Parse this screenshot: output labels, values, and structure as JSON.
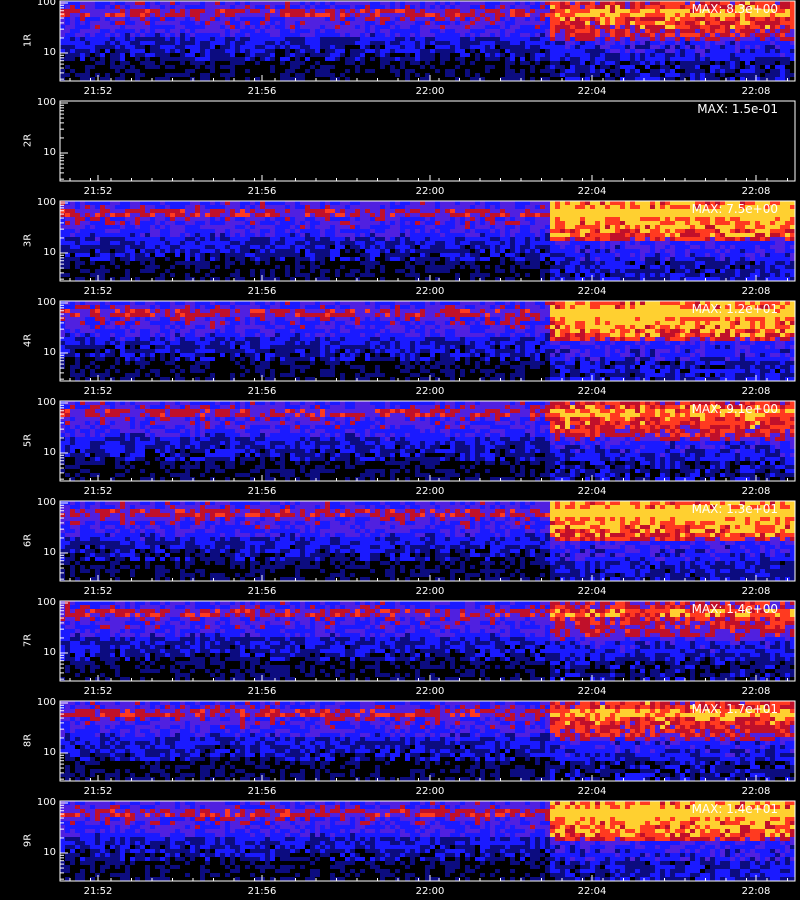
{
  "chart_data": [
    {
      "type": "heatmap",
      "ylabel": "1R",
      "max_label": "MAX: 8.3e+00",
      "y_ticks": [
        "100",
        "10"
      ],
      "yscale": "log",
      "x_ticks": [
        "21:52",
        "21:56",
        "22:00",
        "22:04",
        "22:08"
      ],
      "intensity": "medium"
    },
    {
      "type": "heatmap",
      "ylabel": "2R",
      "max_label": "MAX: 1.5e-01",
      "y_ticks": [
        "100",
        "10"
      ],
      "yscale": "log",
      "x_ticks": [
        "21:52",
        "21:56",
        "22:00",
        "22:04",
        "22:08"
      ],
      "intensity": "empty"
    },
    {
      "type": "heatmap",
      "ylabel": "3R",
      "max_label": "MAX: 7.5e+00",
      "y_ticks": [
        "100",
        "10"
      ],
      "yscale": "log",
      "x_ticks": [
        "21:52",
        "21:56",
        "22:00",
        "22:04",
        "22:08"
      ],
      "intensity": "high"
    },
    {
      "type": "heatmap",
      "ylabel": "4R",
      "max_label": "MAX: 1.2e+01",
      "y_ticks": [
        "100",
        "10"
      ],
      "yscale": "log",
      "x_ticks": [
        "21:52",
        "21:56",
        "22:00",
        "22:04",
        "22:08"
      ],
      "intensity": "high"
    },
    {
      "type": "heatmap",
      "ylabel": "5R",
      "max_label": "MAX: 9.1e+00",
      "y_ticks": [
        "100",
        "10"
      ],
      "yscale": "log",
      "x_ticks": [
        "21:52",
        "21:56",
        "22:00",
        "22:04",
        "22:08"
      ],
      "intensity": "medium"
    },
    {
      "type": "heatmap",
      "ylabel": "6R",
      "max_label": "MAX: 1.3e+01",
      "y_ticks": [
        "100",
        "10"
      ],
      "yscale": "log",
      "x_ticks": [
        "21:52",
        "21:56",
        "22:00",
        "22:04",
        "22:08"
      ],
      "intensity": "high"
    },
    {
      "type": "heatmap",
      "ylabel": "7R",
      "max_label": "MAX: 1.4e+00",
      "y_ticks": [
        "100",
        "10"
      ],
      "yscale": "log",
      "x_ticks": [
        "21:52",
        "21:56",
        "22:00",
        "22:04",
        "22:08"
      ],
      "intensity": "sparse"
    },
    {
      "type": "heatmap",
      "ylabel": "8R",
      "max_label": "MAX: 1.7e+01",
      "y_ticks": [
        "100",
        "10"
      ],
      "yscale": "log",
      "x_ticks": [
        "21:52",
        "21:56",
        "22:00",
        "22:04",
        "22:08"
      ],
      "intensity": "medium"
    },
    {
      "type": "heatmap",
      "ylabel": "9R",
      "max_label": "MAX: 1.4e+01",
      "y_ticks": [
        "100",
        "10"
      ],
      "yscale": "log",
      "x_ticks": [
        "21:52",
        "21:56",
        "22:00",
        "22:04",
        "22:08"
      ],
      "intensity": "high"
    }
  ],
  "colors": {
    "background": "#000000",
    "low": "#1a1aff",
    "mid": "#c0102a",
    "high": "#ffd030",
    "axis": "#ffffff"
  }
}
